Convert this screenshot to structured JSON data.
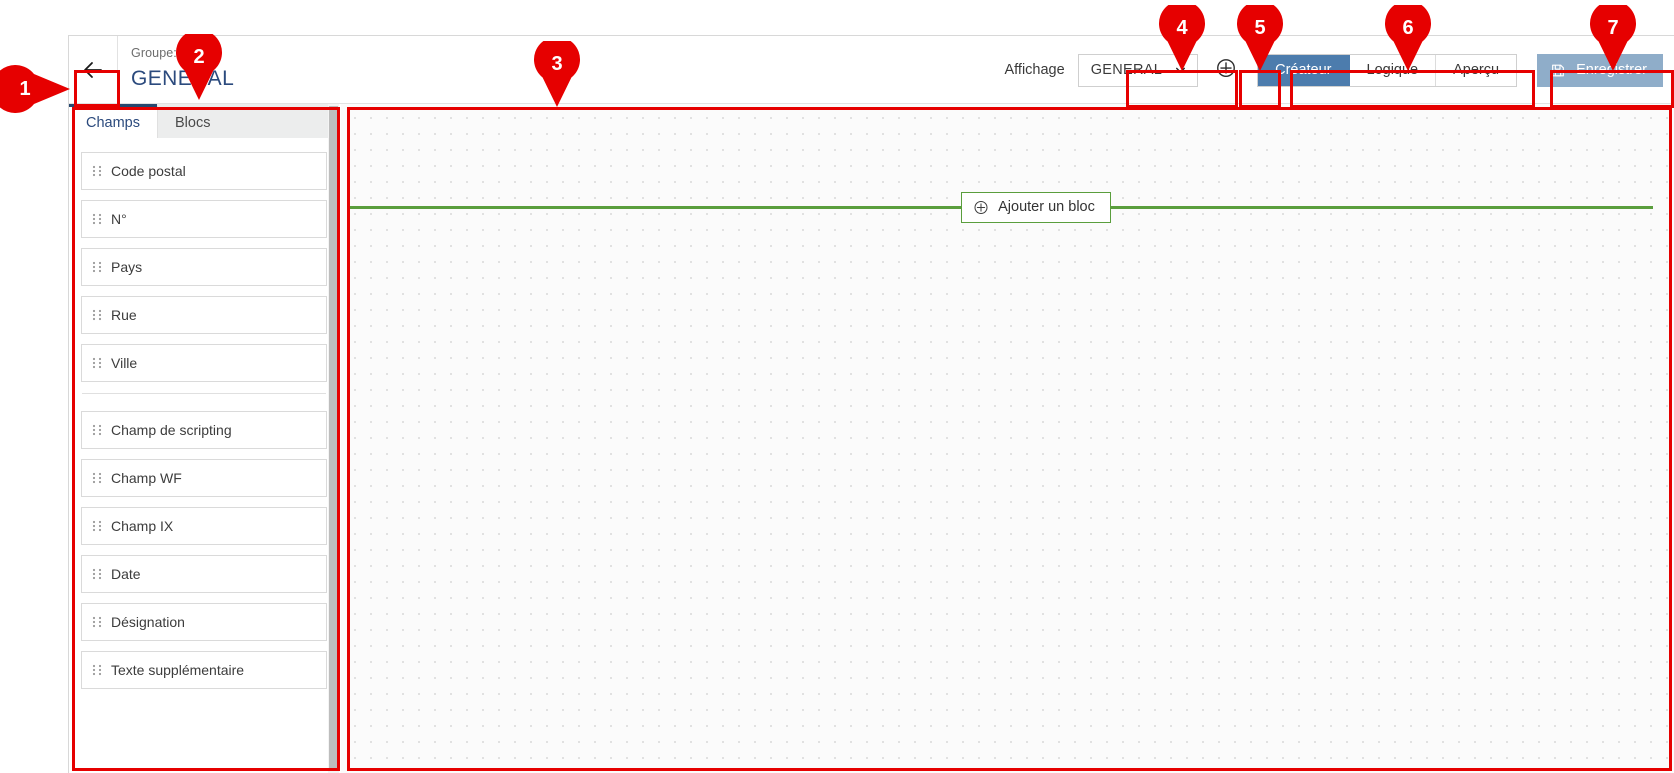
{
  "header": {
    "back_icon": "arrow-left-icon",
    "group_label": "Groupe: Adre",
    "page_title": "GENERAL",
    "affichage_label": "Affichage",
    "display_select": {
      "value": "GENERAL",
      "chevron_icon": "chevron-down-icon"
    },
    "add_display_icon": "plus-circle-icon",
    "segments": [
      {
        "label": "Créateur",
        "active": true
      },
      {
        "label": "Logique",
        "active": false
      },
      {
        "label": "Aperçu",
        "active": false
      }
    ],
    "save": {
      "label": "Enregistrer",
      "icon": "save-floppy-icon"
    }
  },
  "sidebar": {
    "tabs": [
      {
        "label": "Champs",
        "active": true
      },
      {
        "label": "Blocs",
        "active": false
      }
    ],
    "drag_handle_icon": "drag-handle-icon",
    "group_a": [
      {
        "label": "Code postal"
      },
      {
        "label": "N°"
      },
      {
        "label": "Pays"
      },
      {
        "label": "Rue"
      },
      {
        "label": "Ville"
      }
    ],
    "group_b": [
      {
        "label": "Champ de scripting"
      },
      {
        "label": "Champ WF"
      },
      {
        "label": "Champ IX"
      },
      {
        "label": "Date"
      },
      {
        "label": "Désignation"
      },
      {
        "label": "Texte supplémentaire"
      }
    ]
  },
  "canvas": {
    "add_block": {
      "label": "Ajouter un bloc",
      "icon": "plus-circle-icon"
    }
  },
  "annotations": {
    "accent_color": "#e60000",
    "callouts": [
      {
        "number": "1"
      },
      {
        "number": "2"
      },
      {
        "number": "3"
      },
      {
        "number": "4"
      },
      {
        "number": "5"
      },
      {
        "number": "6"
      },
      {
        "number": "7"
      }
    ]
  },
  "colors": {
    "brand_blue": "#2b4a7d",
    "segment_active": "#4c7cad",
    "save_button": "#8fadc9",
    "insert_green": "#5a9e3d",
    "annotation_red": "#e60000"
  }
}
